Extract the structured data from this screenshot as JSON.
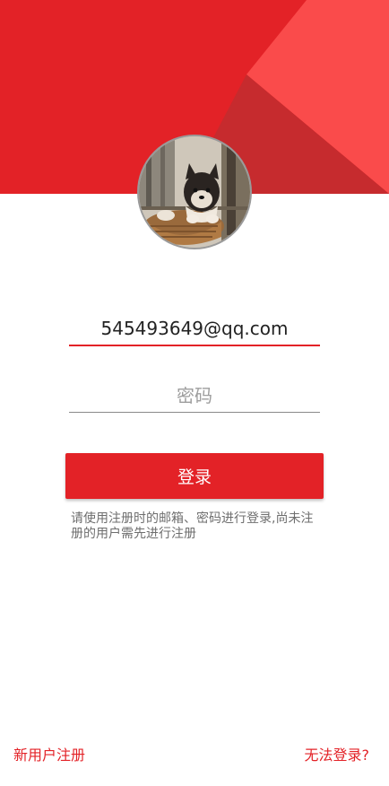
{
  "colors": {
    "primary": "#e32227",
    "header_light": "#fa4b4b",
    "header_dark": "#c62b2e"
  },
  "avatar": {
    "icon": "profile-photo-dog"
  },
  "login_form": {
    "email_value": "545493649@qq.com",
    "password_placeholder": "密码",
    "login_label": "登录",
    "hint": "请使用注册时的邮箱、密码进行登录,尚未注册的用户需先进行注册"
  },
  "footer": {
    "register_label": "新用户注册",
    "cannot_login_label": "无法登录?"
  }
}
